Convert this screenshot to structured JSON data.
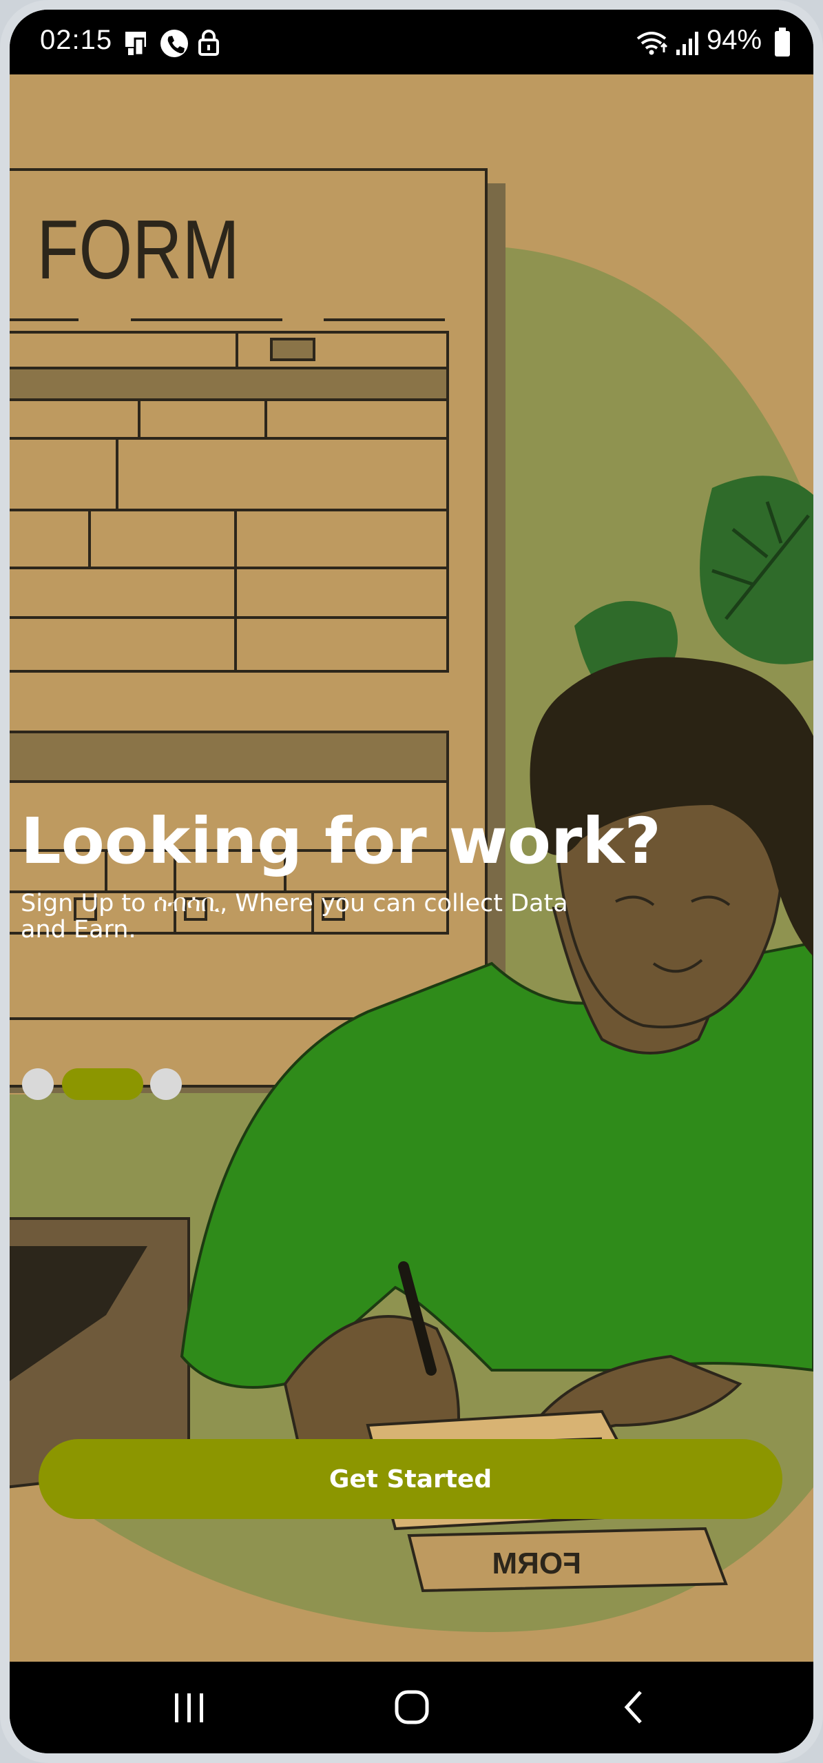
{
  "status_bar": {
    "time": "02:15",
    "battery": "94%",
    "left_icons": [
      "screen-mirror-icon",
      "phone-call-icon",
      "lock-icon"
    ],
    "right_icons": [
      "wifi-icon",
      "signal-icon",
      "battery-icon"
    ]
  },
  "onboarding": {
    "illustration": "person-filling-form-illustration",
    "form_sign_text": "FORM",
    "form_paper_text": "FORM",
    "headline": "Looking for work?",
    "subtitle": "Sign Up to  ሰብሳቢ, Where you can collect Data and Earn.",
    "pagination": {
      "total": 3,
      "active_index": 1
    },
    "cta_label": "Get Started"
  },
  "nav_bar": {
    "buttons": [
      "recent-apps-icon",
      "home-icon",
      "back-icon"
    ]
  },
  "colors": {
    "background": "#be9a60",
    "accent": "#8c9600",
    "shirt": "#2f8b1a",
    "blob": "#8f9350",
    "inactive_dot": "#d9d9d9"
  }
}
